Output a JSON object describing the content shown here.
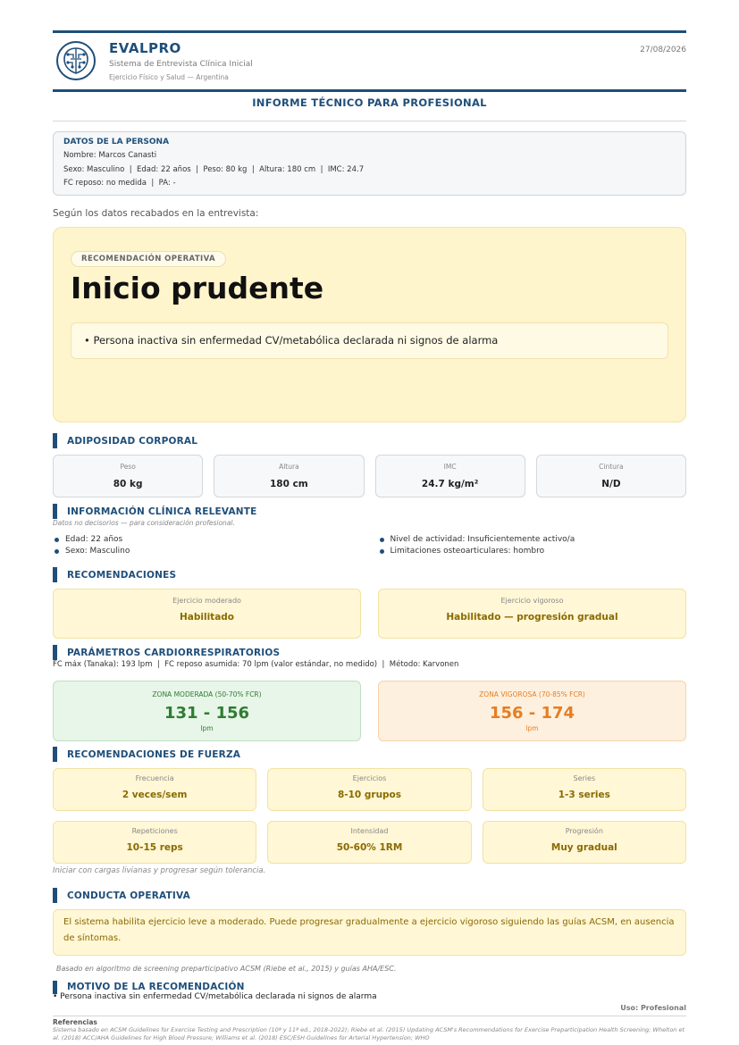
{
  "header": {
    "brand": "EVALPRO",
    "subtitle": "Sistema de Entrevista Clínica Inicial",
    "subtitle2": "Ejercicio Físico y Salud — Argentina",
    "date": "27/08/2026",
    "report_title": "INFORME TÉCNICO PARA PROFESIONAL",
    "logo_icon": "brain-circuit-icon"
  },
  "person": {
    "title": "DATOS DE LA PERSONA",
    "name_line": "Nombre: Marcos Canasti",
    "data_line": "Sexo: Masculino  |  Edad: 22 años  |  Peso: 80 kg  |  Altura: 180 cm  |  IMC: 24.7",
    "vitals_line": "FC reposo: no medida  |  PA: -"
  },
  "intro": "Según los datos recabados en la entrevista:",
  "recommendation": {
    "pill": "RECOMENDACIÓN OPERATIVA",
    "title": "Inicio prudente",
    "reason": "• Persona inactiva sin enfermedad CV/metabólica declarada ni signos de alarma"
  },
  "adiposity": {
    "title": "ADIPOSIDAD CORPORAL",
    "items": [
      {
        "label": "Peso",
        "value": "80 kg"
      },
      {
        "label": "Altura",
        "value": "180 cm"
      },
      {
        "label": "IMC",
        "value": "24.7 kg/m²"
      },
      {
        "label": "Cintura",
        "value": "N/D"
      }
    ]
  },
  "clinical": {
    "title": "INFORMACIÓN CLÍNICA RELEVANTE",
    "note": "Datos no decisorios — para consideración profesional.",
    "left": [
      "Edad: 22 años",
      "Sexo: Masculino"
    ],
    "right": [
      "Nivel de actividad: Insuficientemente activo/a",
      "Limitaciones osteoarticulares: hombro"
    ]
  },
  "recommendations": {
    "title": "RECOMENDACIONES",
    "items": [
      {
        "label": "Ejercicio moderado",
        "value": "Habilitado"
      },
      {
        "label": "Ejercicio vigoroso",
        "value": "Habilitado — progresión gradual"
      }
    ]
  },
  "cardio": {
    "title": "PARÁMETROS CARDIORRESPIRATORIOS",
    "line": "FC máx (Tanaka): 193 lpm  |  FC reposo asumida: 70 lpm (valor estándar, no medido)  |  Método: Karvonen",
    "moderate": {
      "label": "ZONA MODERADA (50-70% FCR)",
      "value": "131 - 156",
      "unit": "lpm"
    },
    "vigorous": {
      "label": "ZONA VIGOROSA (70-85% FCR)",
      "value": "156 - 174",
      "unit": "lpm"
    }
  },
  "strength": {
    "title": "RECOMENDACIONES DE FUERZA",
    "items": [
      {
        "label": "Frecuencia",
        "value": "2 veces/sem"
      },
      {
        "label": "Ejercicios",
        "value": "8-10 grupos"
      },
      {
        "label": "Series",
        "value": "1-3 series"
      },
      {
        "label": "Repeticiones",
        "value": "10-15 reps"
      },
      {
        "label": "Intensidad",
        "value": "50-60% 1RM"
      },
      {
        "label": "Progresión",
        "value": "Muy gradual"
      }
    ],
    "note": "Iniciar con cargas livianas y progresar según tolerancia."
  },
  "conduct": {
    "title": "CONDUCTA OPERATIVA",
    "text": "El sistema habilita ejercicio leve a moderado. Puede progresar gradualmente a ejercicio vigoroso siguiendo las guías ACSM, en ausencia de síntomas."
  },
  "basis": "Basado en algoritmo de screening preparticipativo ACSM (Riebe et al., 2015) y guías AHA/ESC.",
  "motive": {
    "title": "MOTIVO DE LA RECOMENDACIÓN",
    "line": "• Persona inactiva sin enfermedad CV/metabólica declarada ni signos de alarma"
  },
  "usage": "Uso: Profesional",
  "references": {
    "title": "Referencias",
    "text": "Sistema basado en ACSM Guidelines for Exercise Testing and Prescription (10ª y 11ª ed., 2018-2022); Riebe et al. (2015) Updating ACSM's Recommendations for Exercise Preparticipation Health Screening; Whelton et al. (2018) ACC/AHA Guidelines for High Blood Pressure; Williams et al. (2018) ESC/ESH Guidelines for Arterial Hypertension; WHO"
  },
  "colors": {
    "accent": "#1f4e79",
    "recommendation_bg": "#fff5cc",
    "moderate_zone": "#2e7d32",
    "vigorous_zone": "#e67e22",
    "enabled_text": "#8a6a00"
  }
}
